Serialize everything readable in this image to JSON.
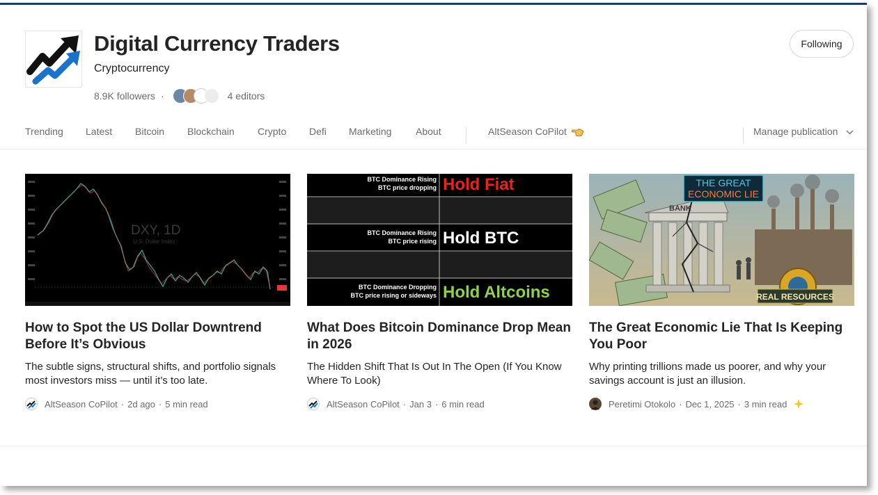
{
  "publication": {
    "name": "Digital Currency Traders",
    "tagline": "Cryptocurrency",
    "followers": "8.9K followers",
    "separator": "·",
    "editors": "4 editors",
    "follow_label": "Following"
  },
  "nav": {
    "items": [
      "Trending",
      "Latest",
      "Bitcoin",
      "Blockchain",
      "Crypto",
      "Defi",
      "Marketing",
      "About"
    ],
    "extra_label": "AltSeason CoPilot",
    "extra_icon": "pointing-hand-icon",
    "manage_label": "Manage publication"
  },
  "articles": [
    {
      "title": "How to Spot the US Dollar Downtrend Before It’s Obvious",
      "subtitle": "The subtle signs, structural shifts, and portfolio signals most investors miss — until it’s too late.",
      "author": "AltSeason CoPilot",
      "date": "2d ago",
      "read_time": "5 min read",
      "image": {
        "title": "DXY, 1D",
        "subtitle": "U.S. Dollar Index"
      }
    },
    {
      "title": "What Does Bitcoin Dominance Drop Mean in 2026",
      "subtitle": "The Hidden Shift That Is Out In The Open (If You Know Where To Look)",
      "author": "AltSeason CoPilot",
      "date": "Jan 3",
      "read_time": "6 min read",
      "image": {
        "rows": [
          {
            "line1": "BTC Dominance Rising",
            "line2": "BTC price dropping",
            "label": "Hold Fiat",
            "color": "#e8231f"
          },
          {
            "line1": "BTC Dominance Rising",
            "line2": "BTC price rising",
            "label": "Hold BTC",
            "color": "#ffffff"
          },
          {
            "line1": "BTC Dominance Dropping",
            "line2": "BTC price rising or sideways",
            "label": "Hold Altcoins",
            "color": "#8fd14f"
          }
        ]
      }
    },
    {
      "title": "The Great Economic Lie That Is Keeping You Poor",
      "subtitle": "Why printing trillions made us poorer, and why your savings account is just an illusion.",
      "author": "Peretimi Otokolo",
      "date": "Dec 1, 2025",
      "read_time": "3 min read",
      "image": {
        "banner_line1": "THE GREAT",
        "banner_line2": "ECONOMIC LIE",
        "bank": "BANK",
        "badge": "REAL RESOURCES"
      }
    }
  ],
  "colors": {
    "accent_blue": "#1a73c9",
    "text": "#242424",
    "muted": "#6b6b6b",
    "star": "#f5c518"
  }
}
